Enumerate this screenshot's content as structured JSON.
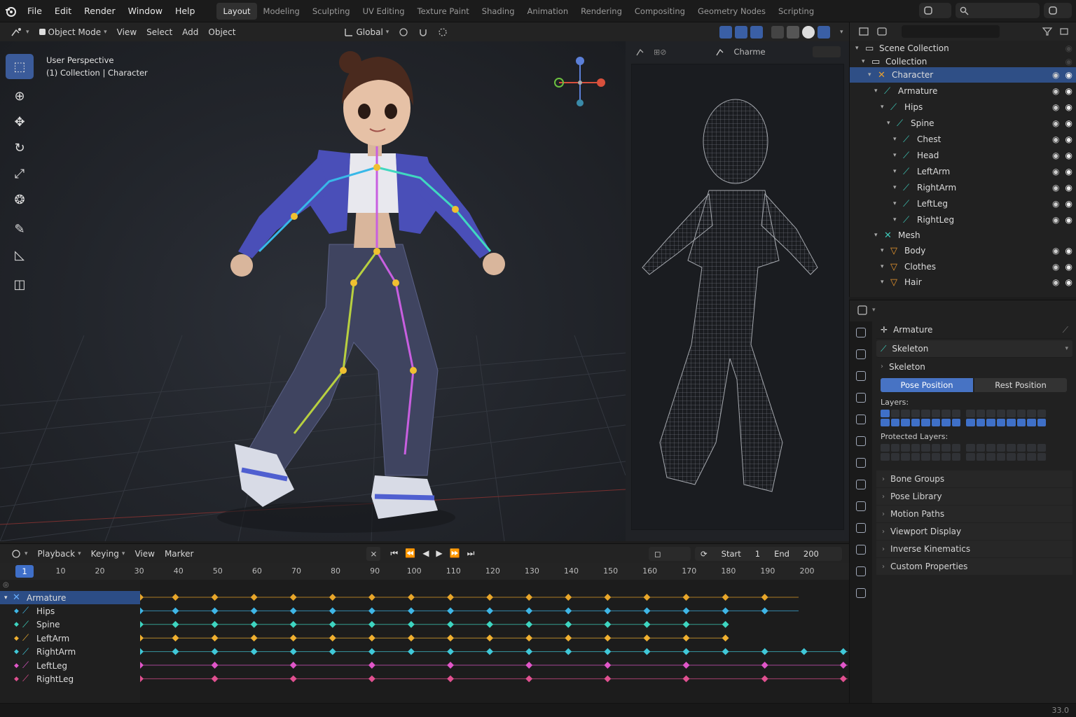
{
  "menu": [
    "File",
    "Edit",
    "Render",
    "Window",
    "Help"
  ],
  "workspaces": [
    "Layout",
    "Modeling",
    "Sculpting",
    "UV Editing",
    "Texture Paint",
    "Shading",
    "Animation",
    "Rendering",
    "Compositing",
    "Geometry Nodes",
    "Scripting"
  ],
  "active_workspace": "Layout",
  "viewport_header": {
    "mode": "Object Mode",
    "menus": [
      "View",
      "Select",
      "Add",
      "Object"
    ],
    "transform_orientation": "Global"
  },
  "viewport_info": {
    "line1": "User Perspective",
    "line2": "(1) Collection | Character"
  },
  "side_viewport": {
    "label": "Charme"
  },
  "tools": [
    "select-box-icon",
    "cursor-icon",
    "move-icon",
    "rotate-icon",
    "scale-icon",
    "transform-icon",
    "annotate-icon",
    "measure-icon",
    "add-cube-icon"
  ],
  "outliner": {
    "rows": [
      {
        "label": "Scene Collection",
        "depth": 0,
        "icon": "scene-collection-icon",
        "vis": false
      },
      {
        "label": "Collection",
        "depth": 1,
        "icon": "collection-icon",
        "vis": false
      },
      {
        "label": "Character",
        "depth": 2,
        "icon": "armature-icon",
        "vis": true,
        "selected": true
      },
      {
        "label": "Armature",
        "depth": 3,
        "icon": "armature-data-icon",
        "vis": true
      },
      {
        "label": "Hips",
        "depth": 4,
        "icon": "bone-icon",
        "vis": true
      },
      {
        "label": "Spine",
        "depth": 5,
        "icon": "bone-icon",
        "vis": true
      },
      {
        "label": "Chest",
        "depth": 6,
        "icon": "bone-icon",
        "vis": true
      },
      {
        "label": "Head",
        "depth": 6,
        "icon": "bone-icon",
        "vis": true
      },
      {
        "label": "LeftArm",
        "depth": 6,
        "icon": "bone-icon",
        "vis": true
      },
      {
        "label": "RightArm",
        "depth": 6,
        "icon": "bone-icon",
        "vis": true
      },
      {
        "label": "LeftLeg",
        "depth": 6,
        "icon": "bone-icon",
        "vis": true
      },
      {
        "label": "RightLeg",
        "depth": 6,
        "icon": "bone-icon",
        "vis": true
      },
      {
        "label": "Mesh",
        "depth": 3,
        "icon": "mesh-group-icon",
        "vis": false
      },
      {
        "label": "Body",
        "depth": 4,
        "icon": "mesh-icon",
        "vis": true
      },
      {
        "label": "Clothes",
        "depth": 4,
        "icon": "mesh-icon",
        "vis": true
      },
      {
        "label": "Hair",
        "depth": 4,
        "icon": "mesh-icon",
        "vis": true
      }
    ]
  },
  "properties": {
    "data_block": "Armature",
    "name_field": "Skeleton",
    "panel_skeleton": "Skeleton",
    "pose_position": "Pose Position",
    "rest_position": "Rest Position",
    "layers_label": "Layers:",
    "protected_layers_label": "Protected Layers:",
    "panels": [
      "Bone Groups",
      "Pose Library",
      "Motion Paths",
      "Viewport Display",
      "Inverse Kinematics",
      "Custom Properties"
    ]
  },
  "timeline": {
    "menus": [
      "Playback",
      "Keying",
      "View",
      "Marker"
    ],
    "start_label": "Start",
    "start": "1",
    "end_label": "End",
    "end": "200",
    "current_frame": "1",
    "ruler": [
      "10",
      "20",
      "30",
      "40",
      "50",
      "60",
      "70",
      "80",
      "90",
      "100",
      "110",
      "120",
      "130",
      "140",
      "150",
      "160",
      "170",
      "180",
      "190",
      "200"
    ],
    "channels": [
      {
        "label": "Armature",
        "color": "#e8a62a",
        "selected": true
      },
      {
        "label": "Hips",
        "color": "#3fb6e6"
      },
      {
        "label": "Spine",
        "color": "#3ed4c0"
      },
      {
        "label": "LeftArm",
        "color": "#f0b030"
      },
      {
        "label": "RightArm",
        "color": "#40c8d8"
      },
      {
        "label": "LeftLeg",
        "color": "#e056c8"
      },
      {
        "label": "RightLeg",
        "color": "#e05090"
      }
    ]
  },
  "version": "33.0"
}
